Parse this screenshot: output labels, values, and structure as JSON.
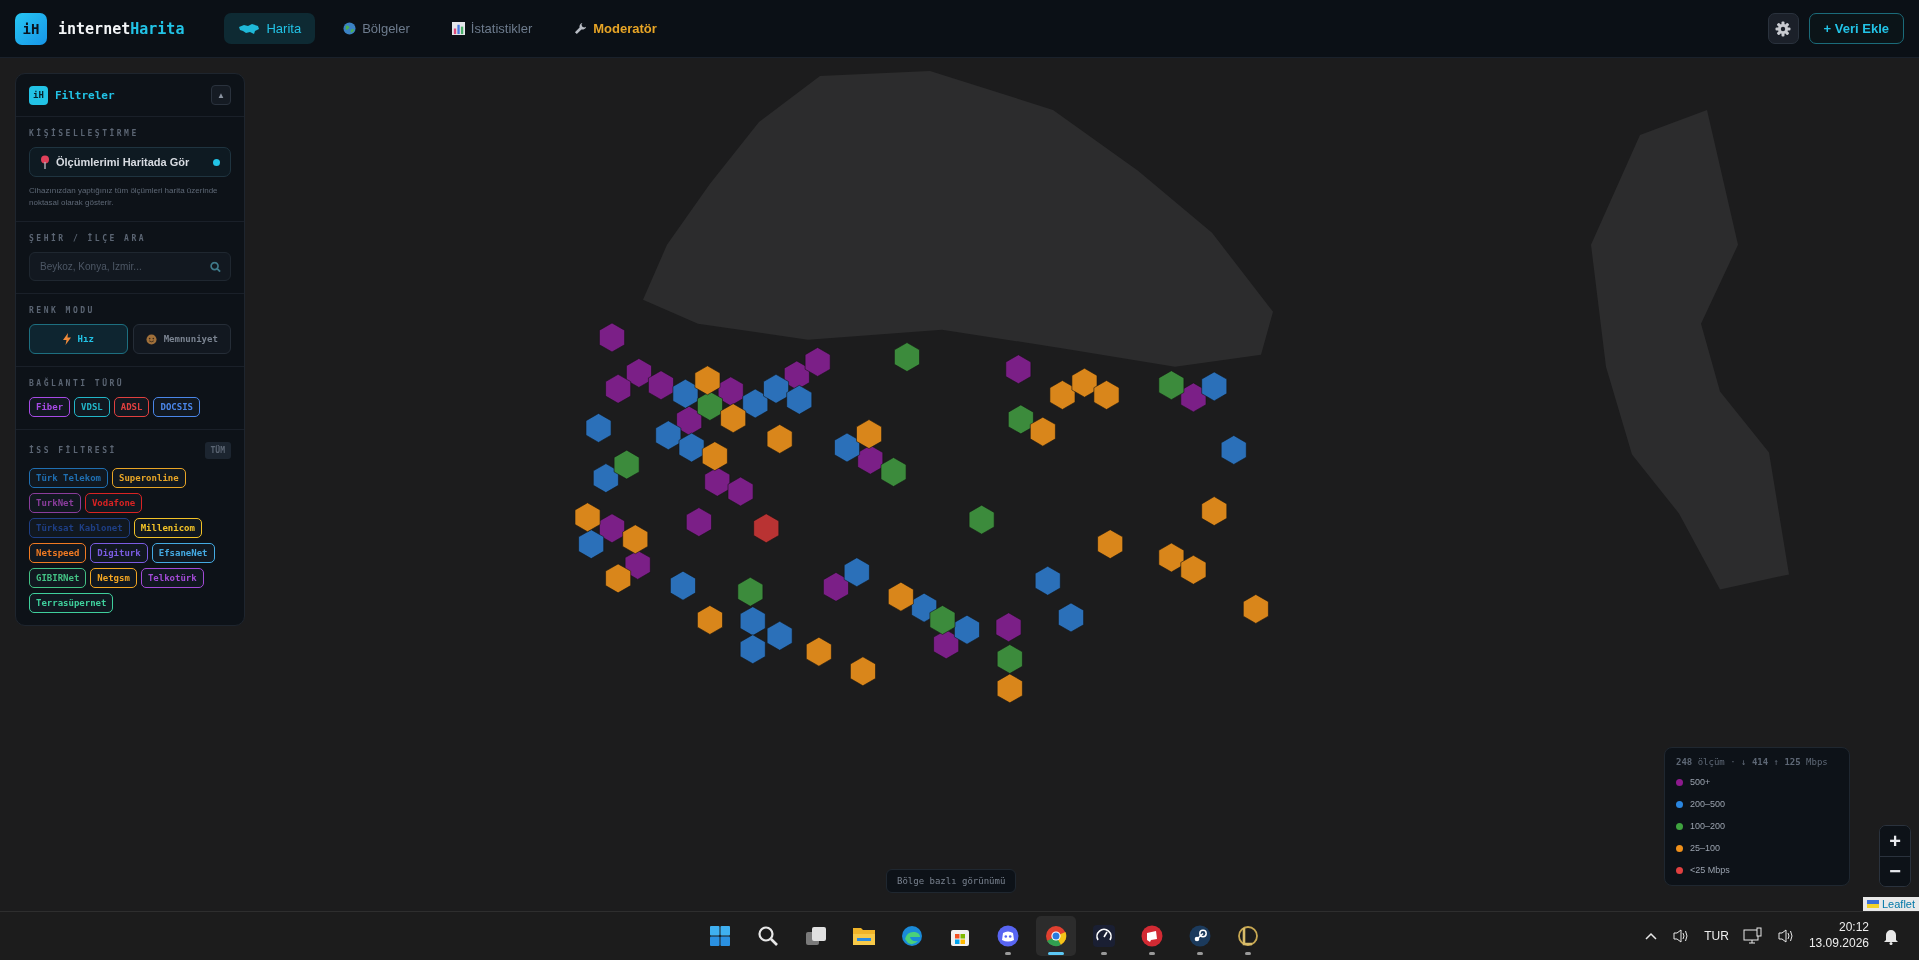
{
  "header": {
    "logo_badge": "iH",
    "logo_name": "internet",
    "logo_accent": "Harita",
    "nav": [
      {
        "label": "Harita",
        "kind": "page",
        "selected": true
      },
      {
        "label": "Bölgeler",
        "kind": "page",
        "selected": false
      },
      {
        "label": "İstatistikler",
        "kind": "page",
        "selected": false
      },
      {
        "label": "Moderatör",
        "kind": "admin",
        "selected": false
      }
    ],
    "add_button": "+ Veri Ekle"
  },
  "filters": {
    "badge": "iH",
    "title": "Filtreler",
    "collapse": "▲",
    "personal": {
      "heading": "KİŞİSELLEŞTİRME",
      "toggle_label": "Ölçümlerimi Haritada Gör",
      "on": true,
      "description": "Cihazınızdan yaptığınız tüm ölçümleri harita üzerinde noktasal olarak gösterir."
    },
    "search": {
      "heading": "ŞEHİR / İLÇE ARA",
      "placeholder": "Beykoz, Konya, İzmir..."
    },
    "color_mode": {
      "heading": "RENK MODU",
      "options": [
        {
          "label": "Hız",
          "selected": true
        },
        {
          "label": "Memnuniyet",
          "selected": false
        }
      ]
    },
    "connection": {
      "heading": "BAĞLANTI TÜRÜ",
      "types": [
        {
          "label": "Fiber",
          "color": "#a74ae6"
        },
        {
          "label": "VDSL",
          "color": "#22b6c8"
        },
        {
          "label": "ADSL",
          "color": "#e0403f"
        },
        {
          "label": "DOCSIS",
          "color": "#4a86e8"
        }
      ]
    },
    "isp": {
      "heading": "İSS FİLTRESİ",
      "all_button": "TÜM",
      "providers": [
        {
          "label": "Türk Telekom",
          "color": "#1f6fb2"
        },
        {
          "label": "Superonline",
          "color": "#e8a526"
        },
        {
          "label": "TurkNet",
          "color": "#8a3d9c"
        },
        {
          "label": "Vodafone",
          "color": "#d92323"
        },
        {
          "label": "Türksat Kablonet",
          "color": "#1e3f86"
        },
        {
          "label": "Millenicom",
          "color": "#f2c227"
        },
        {
          "label": "Netspeed",
          "color": "#f07a22"
        },
        {
          "label": "Digiturk",
          "color": "#7b5ce2"
        },
        {
          "label": "EfsaneNet",
          "color": "#44aae2"
        },
        {
          "label": "GIBIRNet",
          "color": "#43c184"
        },
        {
          "label": "Netgsm",
          "color": "#f2a622"
        },
        {
          "label": "Telkotürk",
          "color": "#a24ad6"
        },
        {
          "label": "Terrasüpernet",
          "color": "#3fcf9c"
        }
      ]
    }
  },
  "map": {
    "hexagons": [
      {
        "color": "#7b1f87"
      },
      {
        "color": "#7b1f87"
      },
      {
        "color": "#7b1f87"
      },
      {
        "color": "#7b1f87"
      },
      {
        "color": "#7b1f87"
      },
      {
        "color": "#7b1f87"
      },
      {
        "color": "#7b1f87"
      },
      {
        "color": "#7b1f87"
      },
      {
        "color": "#7b1f87"
      },
      {
        "color": "#7b1f87"
      },
      {
        "color": "#7b1f87"
      },
      {
        "color": "#7b1f87"
      },
      {
        "color": "#7b1f87"
      },
      {
        "color": "#7b1f87"
      },
      {
        "color": "#7b1f87"
      },
      {
        "color": "#7b1f87"
      },
      {
        "color": "#7b1f87"
      },
      {
        "color": "#7b1f87"
      },
      {
        "color": "#7b1f87"
      },
      {
        "color": "#2b70b9"
      },
      {
        "color": "#2b70b9"
      },
      {
        "color": "#2b70b9"
      },
      {
        "color": "#2b70b9"
      },
      {
        "color": "#2b70b9"
      },
      {
        "color": "#2b70b9"
      },
      {
        "color": "#2b70b9"
      },
      {
        "color": "#2b70b9"
      },
      {
        "color": "#2b70b9"
      },
      {
        "color": "#2b70b9"
      },
      {
        "color": "#2b70b9"
      },
      {
        "color": "#2b70b9"
      },
      {
        "color": "#2b70b9"
      },
      {
        "color": "#2b70b9"
      },
      {
        "color": "#2b70b9"
      },
      {
        "color": "#2b70b9"
      },
      {
        "color": "#2b70b9"
      },
      {
        "color": "#2b70b9"
      },
      {
        "color": "#2b70b9"
      },
      {
        "color": "#2b70b9"
      },
      {
        "color": "#2b70b9"
      },
      {
        "color": "#3c8b3c"
      },
      {
        "color": "#3c8b3c"
      },
      {
        "color": "#3c8b3c"
      },
      {
        "color": "#3c8b3c"
      },
      {
        "color": "#3c8b3c"
      },
      {
        "color": "#3c8b3c"
      },
      {
        "color": "#3c8b3c"
      },
      {
        "color": "#3c8b3c"
      },
      {
        "color": "#3c8b3c"
      },
      {
        "color": "#3c8b3c"
      },
      {
        "color": "#d9861b"
      },
      {
        "color": "#d9861b"
      },
      {
        "color": "#d9861b"
      },
      {
        "color": "#d9861b"
      },
      {
        "color": "#d9861b"
      },
      {
        "color": "#d9861b"
      },
      {
        "color": "#d9861b"
      },
      {
        "color": "#d9861b"
      },
      {
        "color": "#d9861b"
      },
      {
        "color": "#d9861b"
      },
      {
        "color": "#d9861b"
      },
      {
        "color": "#d9861b"
      },
      {
        "color": "#d9861b"
      },
      {
        "color": "#d9861b"
      },
      {
        "color": "#d9861b"
      },
      {
        "color": "#d9861b"
      },
      {
        "color": "#d9861b"
      },
      {
        "color": "#d9861b"
      },
      {
        "color": "#d9861b"
      },
      {
        "color": "#d9861b"
      },
      {
        "color": "#d9861b"
      },
      {
        "color": "#d9861b"
      },
      {
        "color": "#b93333"
      }
    ],
    "hint": "Bölge bazlı görünümü",
    "zoom_in": "+",
    "zoom_out": "−",
    "attribution": "Leaflet"
  },
  "legend": {
    "summary": "**248** ölçüm · ↓ **414** ↑ **125** Mbps",
    "items": [
      {
        "label": "500+",
        "color": "#8e1a8e"
      },
      {
        "label": "200–500",
        "color": "#2a86e0"
      },
      {
        "label": "100–200",
        "color": "#3fa33f"
      },
      {
        "label": "25–100",
        "color": "#f0901a"
      },
      {
        "label": "<25 Mbps",
        "color": "#e04040"
      }
    ]
  },
  "taskbar": {
    "apps": [
      {
        "kind": "start",
        "running": false,
        "selected": false
      },
      {
        "kind": "search",
        "running": false,
        "selected": false
      },
      {
        "kind": "taskview",
        "running": false,
        "selected": false
      },
      {
        "kind": "files",
        "running": false,
        "selected": false
      },
      {
        "kind": "edge",
        "running": false,
        "selected": false
      },
      {
        "kind": "store",
        "running": false,
        "selected": false
      },
      {
        "kind": "discord",
        "running": true,
        "selected": false
      },
      {
        "kind": "chrome",
        "running": true,
        "selected": true
      },
      {
        "kind": "gauge",
        "running": true,
        "selected": false
      },
      {
        "kind": "riot",
        "running": true,
        "selected": false
      },
      {
        "kind": "steam",
        "running": true,
        "selected": false
      },
      {
        "kind": "league",
        "running": true,
        "selected": false
      }
    ],
    "language": "TUR",
    "time": "20:12",
    "date": "13.09.2026"
  }
}
